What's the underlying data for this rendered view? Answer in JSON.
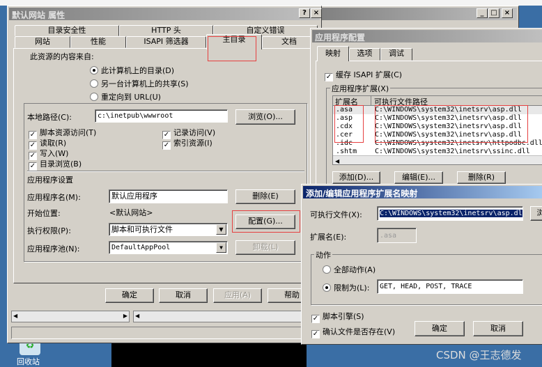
{
  "main_dialog": {
    "title": "默认网站 属性",
    "tabs_row1": [
      "目录安全性",
      "HTTP 头",
      "自定义错误"
    ],
    "tabs_row2": [
      "网站",
      "性能",
      "ISAPI 筛选器",
      "主目录",
      "文档"
    ],
    "content_source_label": "此资源的内容来自:",
    "radios": [
      {
        "label": "此计算机上的目录(D)",
        "checked": true
      },
      {
        "label": "另一台计算机上的共享(S)",
        "checked": false
      },
      {
        "label": "重定向到 URL(U)",
        "checked": false
      }
    ],
    "local_path_label": "本地路径(C):",
    "local_path_value": "c:\\inetpub\\wwwroot",
    "browse_button": "浏览(O)...",
    "checkboxes_left": [
      {
        "label": "脚本资源访问(T)",
        "checked": true
      },
      {
        "label": "读取(R)",
        "checked": true
      },
      {
        "label": "写入(W)",
        "checked": true
      },
      {
        "label": "目录浏览(B)",
        "checked": true
      }
    ],
    "checkboxes_right": [
      {
        "label": "记录访问(V)",
        "checked": true
      },
      {
        "label": "索引资源(I)",
        "checked": true
      }
    ],
    "app_settings_label": "应用程序设置",
    "app_name_label": "应用程序名(M):",
    "app_name_value": "默认应用程序",
    "remove_button": "删除(E)",
    "start_point_label": "开始位置:",
    "start_point_value": "<默认网站>",
    "config_button": "配置(G)...",
    "exec_perm_label": "执行权限(P):",
    "exec_perm_value": "脚本和可执行文件",
    "app_pool_label": "应用程序池(N):",
    "app_pool_value": "DefaultAppPool",
    "unload_button": "卸载(L)",
    "ok": "确定",
    "cancel": "取消",
    "apply": "应用(A)",
    "help": "帮助"
  },
  "app_config": {
    "title": "应用程序配置",
    "tabs": [
      "映射",
      "选项",
      "调试"
    ],
    "cache_label": "缓存 ISAPI 扩展(C)",
    "cache_checked": true,
    "group_label": "应用程序扩展(X)",
    "columns": [
      "扩展名",
      "可执行文件路径"
    ],
    "rows": [
      [
        ".asa",
        "C:\\WINDOWS\\system32\\inetsrv\\asp.dll"
      ],
      [
        ".asp",
        "C:\\WINDOWS\\system32\\inetsrv\\asp.dll"
      ],
      [
        ".cdx",
        "C:\\WINDOWS\\system32\\inetsrv\\asp.dll"
      ],
      [
        ".cer",
        "C:\\WINDOWS\\system32\\inetsrv\\asp.dll"
      ],
      [
        ".idc",
        "C:\\WINDOWS\\system32\\inetsrv\\httpodbc.dll"
      ],
      [
        ".shtm",
        "C:\\WINDOWS\\system32\\inetsrv\\ssinc.dll"
      ]
    ],
    "add_button": "添加(D)...",
    "edit_button": "编辑(E)...",
    "delete_button": "删除(R)"
  },
  "edit_dialog": {
    "title": "添加/编辑应用程序扩展名映射",
    "exec_label": "可执行文件(X):",
    "exec_value": "C:\\WINDOWS\\system32\\inetsrv\\asp.dll",
    "browse_button": "浏",
    "ext_label": "扩展名(E):",
    "ext_value": ".asa",
    "verbs_group": "动作",
    "all_verbs": "全部动作(A)",
    "limit_to": "限制为(L):",
    "limit_value": "GET, HEAD, POST, TRACE",
    "script_engine": "脚本引擎(S)",
    "verify_file": "确认文件是否存在(V)",
    "ok": "确定",
    "cancel": "取消"
  },
  "desktop": {
    "recycle_bin": "回收站"
  },
  "watermark": "CSDN @王志德发"
}
